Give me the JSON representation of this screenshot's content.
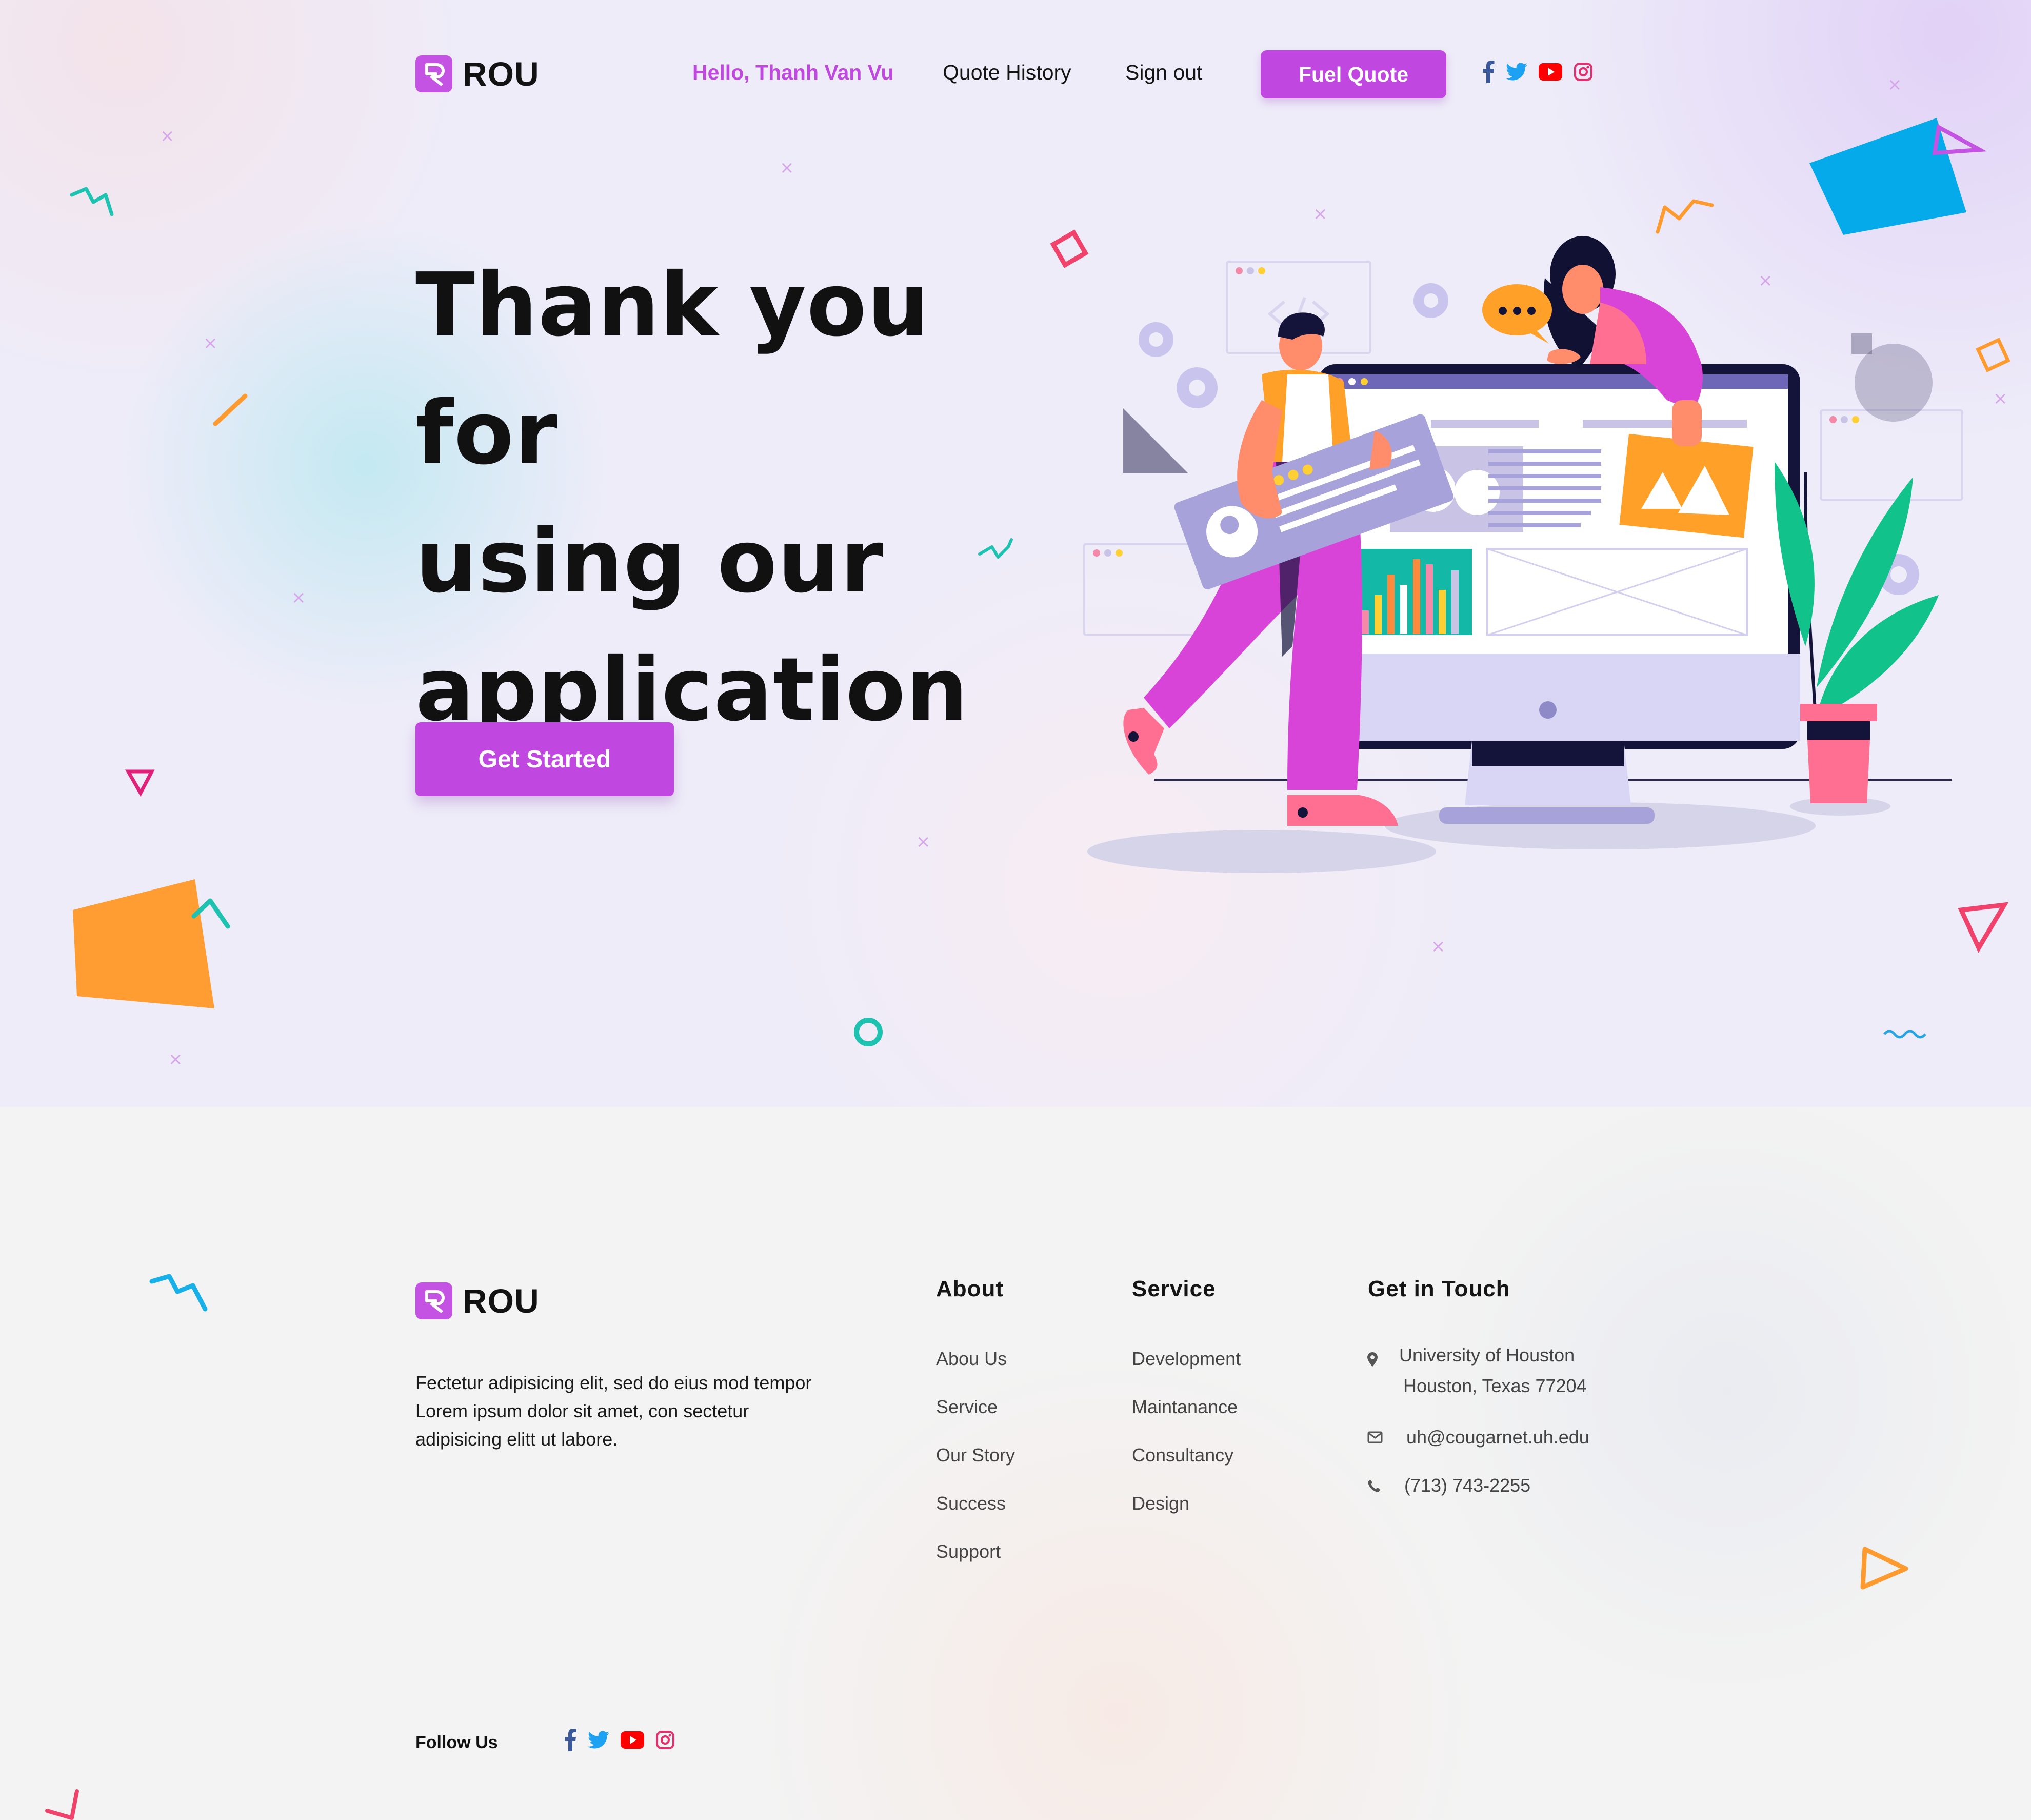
{
  "brand": {
    "name": "ROU",
    "color": "#c452e2"
  },
  "nav": {
    "greeting": "Hello, Thanh Van Vu",
    "quote_history": "Quote History",
    "sign_out": "Sign out",
    "fuel_quote": "Fuel Quote",
    "social": [
      "facebook-icon",
      "twitter-icon",
      "youtube-icon",
      "instagram-icon"
    ]
  },
  "hero": {
    "line1": "Thank you for",
    "line2": "using our",
    "line3": "application",
    "cta": "Get Started"
  },
  "footer": {
    "description": "Fectetur adipisicing elit, sed do eius mod tempor Lorem ipsum dolor sit amet, con sectetur adipisicing elitt ut labore.",
    "about": {
      "title": "About",
      "links": [
        "Abou Us",
        "Service",
        "Our Story",
        "Success",
        "Support"
      ]
    },
    "service": {
      "title": "Service",
      "links": [
        "Development",
        "Maintanance",
        "Consultancy",
        "Design"
      ]
    },
    "contact": {
      "title": "Get in Touch",
      "address_line1": "University of Houston",
      "address_line2": "Houston, Texas 77204",
      "email": "uh@cougarnet.uh.edu",
      "phone": "(713) 743-2255"
    },
    "follow_label": "Follow Us"
  },
  "colors": {
    "accent": "#c048e0",
    "facebook": "#3b5998",
    "twitter": "#1da1f2",
    "youtube": "#ff0000",
    "instagram": "#e1306c"
  }
}
